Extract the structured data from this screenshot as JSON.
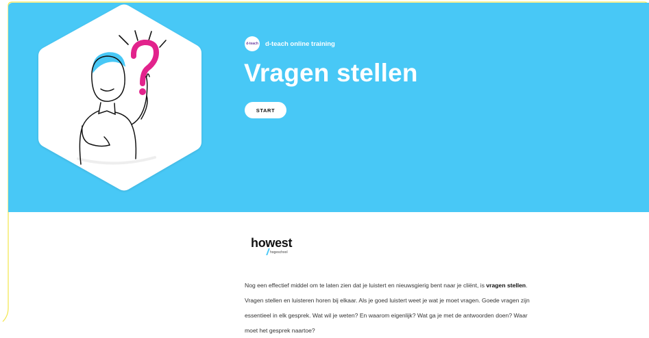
{
  "hero": {
    "brand_logo_text": "d-teach",
    "brand_label": "d-teach online training",
    "title": "Vragen stellen",
    "start_label": "START",
    "colors": {
      "background": "#48c8f6",
      "text": "#ffffff"
    },
    "illustration": "person-with-question-mark-illustration"
  },
  "partner": {
    "name": "howest",
    "tagline": "hogeschool"
  },
  "intro": {
    "part1": "Nog een effectief middel om te laten zien dat je luistert en nieuwsgierig bent naar je cliënt, is ",
    "bold": "vragen stellen",
    "part2": ". Vragen stellen en luisteren horen bij elkaar. Als je goed luistert weet je wat je moet vragen. Goede vragen zijn essentieel in elk gesprek. Wat wil je weten? En waarom eigenlijk? Wat ga je met de antwoorden doen? Waar moet het gesprek naartoe?"
  }
}
